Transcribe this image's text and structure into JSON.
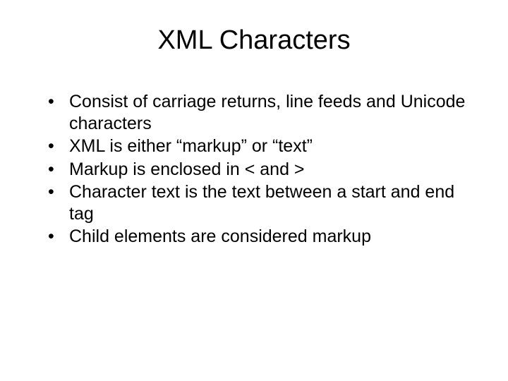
{
  "slide": {
    "title": "XML Characters",
    "bullets": [
      "Consist of carriage returns, line feeds and Unicode characters",
      "XML is either “markup” or “text”",
      "Markup is enclosed in < and >",
      "Character text is the text between a start and end tag",
      "Child elements are considered markup"
    ]
  }
}
